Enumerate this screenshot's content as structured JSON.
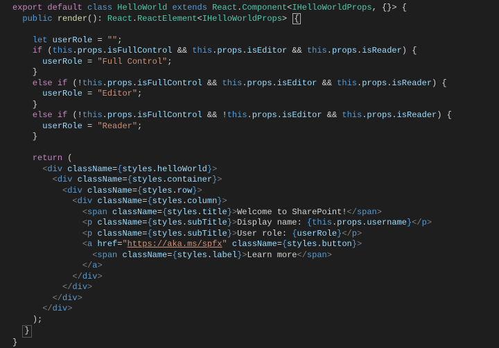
{
  "code": {
    "l1": {
      "export": "export",
      "default": "default",
      "class": "class",
      "className": "HelloWorld",
      "extends": "extends",
      "react": "React",
      "component": "Component",
      "iprops": "IHelloWorldProps"
    },
    "l2": {
      "public": "public",
      "render": "render",
      "react": "React",
      "reactElement": "ReactElement",
      "iprops": "IHelloWorldProps"
    },
    "l4": {
      "let": "let",
      "userRole": "userRole",
      "empty": "\"\""
    },
    "l5": {
      "if": "if",
      "this1": "this",
      "this2": "this",
      "this3": "this",
      "props1": "props",
      "props2": "props",
      "props3": "props",
      "isFullControl": "isFullControl",
      "isEditor": "isEditor",
      "isReader": "isReader"
    },
    "l6": {
      "userRole": "userRole",
      "val": "\"Full Control\""
    },
    "l8": {
      "else": "else",
      "if": "if",
      "this1": "this",
      "this2": "this",
      "this3": "this",
      "props1": "props",
      "props2": "props",
      "props3": "props",
      "isFullControl": "isFullControl",
      "isEditor": "isEditor",
      "isReader": "isReader"
    },
    "l9": {
      "userRole": "userRole",
      "val": "\"Editor\""
    },
    "l11": {
      "else": "else",
      "if": "if",
      "this1": "this",
      "this2": "this",
      "this3": "this",
      "props1": "props",
      "props2": "props",
      "props3": "props",
      "isFullControl": "isFullControl",
      "isEditor": "isEditor",
      "isReader": "isReader"
    },
    "l12": {
      "userRole": "userRole",
      "val": "\"Reader\""
    },
    "l15": {
      "return": "return"
    },
    "l16": {
      "div": "div",
      "className": "className",
      "styles": "styles",
      "prop": "helloWorld"
    },
    "l17": {
      "div": "div",
      "className": "className",
      "styles": "styles",
      "prop": "container"
    },
    "l18": {
      "div": "div",
      "className": "className",
      "styles": "styles",
      "prop": "row"
    },
    "l19": {
      "div": "div",
      "className": "className",
      "styles": "styles",
      "prop": "column"
    },
    "l20": {
      "span": "span",
      "className": "className",
      "styles": "styles",
      "prop": "title",
      "text": "Welcome to SharePoint!",
      "close": "span"
    },
    "l21": {
      "p": "p",
      "className": "className",
      "styles": "styles",
      "prop": "subTitle",
      "text1": "Display name: ",
      "this": "this",
      "props": "props",
      "username": "username",
      "close": "p"
    },
    "l22": {
      "p": "p",
      "className": "className",
      "styles": "styles",
      "prop": "subTitle",
      "text1": "User role: ",
      "userRole": "userRole",
      "close": "p"
    },
    "l23": {
      "a": "a",
      "href": "href",
      "url": "https://aka.ms/spfx",
      "className": "className",
      "styles": "styles",
      "prop": "button"
    },
    "l24": {
      "span": "span",
      "className": "className",
      "styles": "styles",
      "prop": "label",
      "text": "Learn more",
      "close": "span"
    },
    "l25": {
      "a": "a"
    },
    "l26": {
      "div": "div"
    },
    "l27": {
      "div": "div"
    },
    "l28": {
      "div": "div"
    },
    "l29": {
      "div": "div"
    }
  }
}
